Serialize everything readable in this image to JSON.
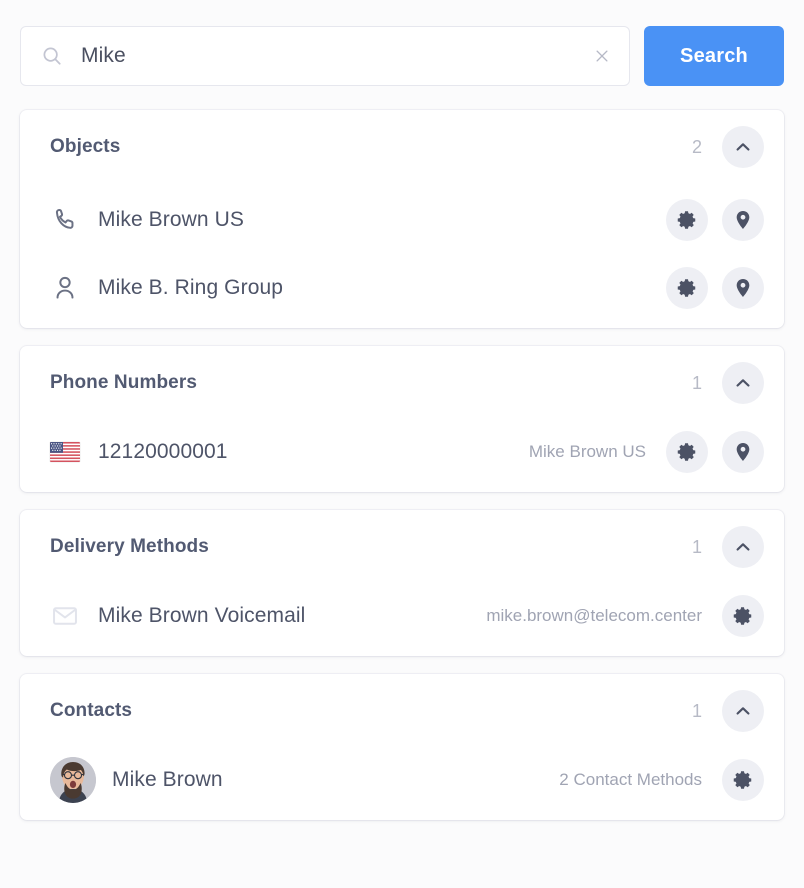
{
  "search": {
    "value": "Mike",
    "placeholder": "Search",
    "button_label": "Search",
    "search_icon": "search-icon",
    "clear_icon": "close-icon",
    "button_color": "#4a92f5"
  },
  "sections": [
    {
      "title": "Objects",
      "count": "2",
      "collapse_icon": "chevron-up-icon",
      "rows": [
        {
          "icon": "phone-icon",
          "label": "Mike Brown US",
          "meta": "",
          "actions": [
            "gear-icon",
            "map-pin-icon"
          ]
        },
        {
          "icon": "user-icon",
          "label": "Mike B. Ring Group",
          "meta": "",
          "actions": [
            "gear-icon",
            "map-pin-icon"
          ]
        }
      ]
    },
    {
      "title": "Phone Numbers",
      "count": "1",
      "collapse_icon": "chevron-up-icon",
      "rows": [
        {
          "icon": "us-flag-icon",
          "label": "12120000001",
          "meta": "Mike Brown US",
          "actions": [
            "gear-icon",
            "map-pin-icon"
          ]
        }
      ]
    },
    {
      "title": "Delivery Methods",
      "count": "1",
      "collapse_icon": "chevron-up-icon",
      "rows": [
        {
          "icon": "envelope-icon",
          "label": "Mike Brown Voicemail",
          "meta": "mike.brown@telecom.center",
          "actions": [
            "gear-icon"
          ]
        }
      ]
    },
    {
      "title": "Contacts",
      "count": "1",
      "collapse_icon": "chevron-up-icon",
      "rows": [
        {
          "icon": "avatar-photo",
          "label": "Mike Brown",
          "meta": "2 Contact Methods",
          "actions": [
            "gear-icon"
          ]
        }
      ]
    }
  ]
}
